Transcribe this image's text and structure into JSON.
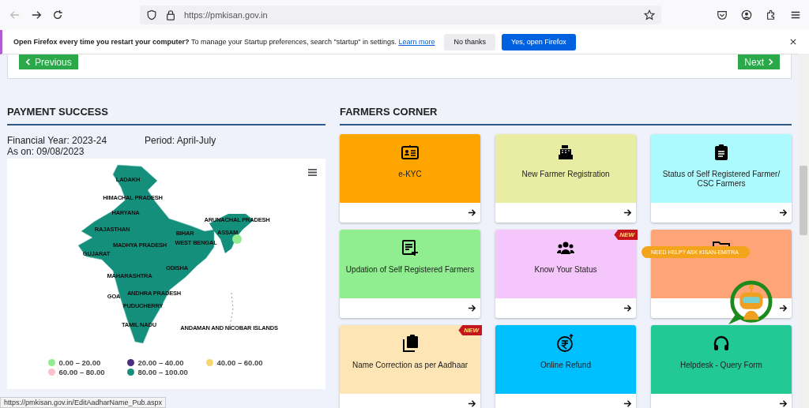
{
  "browser": {
    "url": "https://pmkisan.gov.in"
  },
  "notification": {
    "bold": "Open Firefox every time you restart your computer?",
    "text": "To manage your Startup preferences, search \"startup\" in settings.",
    "link": "Learn more",
    "buttons": [
      {
        "label": "No thanks",
        "primary": false
      },
      {
        "label": "Yes, open Firefox",
        "primary": true
      }
    ]
  },
  "pager": {
    "previous": "Previous",
    "next": "Next"
  },
  "payment_success": {
    "title": "PAYMENT SUCCESS",
    "financial_year": "Financial Year: 2023-24",
    "period": "Period: April-July",
    "as_on": "As on: 09/08/2023",
    "map_labels": [
      "LADAKH",
      "HIMACHAL PRADESH",
      "HARYANA",
      "RAJASTHAN",
      "BIHAR",
      "ARUNACHAL PRADESH",
      "ASSAM",
      "MADHYA PRADESH",
      "WEST BENGAL",
      "GUJARAT",
      "ODISHA",
      "MAHARASHTRA",
      "GOA",
      "ANDHRA PRADESH",
      "PUDUCHERRY",
      "TAMIL NADU",
      "ANDAMAN AND NICOBAR ISLANDS"
    ],
    "legend": [
      {
        "label": "0.00 – 20.00",
        "color": "#90ee90"
      },
      {
        "label": "20.00 – 40.00",
        "color": "#4b2c7f"
      },
      {
        "label": "40.00 – 60.00",
        "color": "#f5d76e"
      },
      {
        "label": "60.00 – 80.00",
        "color": "#ffc0cb"
      },
      {
        "label": "80.00 – 100.00",
        "color": "#148f7b"
      }
    ]
  },
  "farmers_corner": {
    "title": "FARMERS CORNER",
    "cards": [
      {
        "label": "e-KYC",
        "color": "#ffa500"
      },
      {
        "label": "New Farmer Registration",
        "color": "#e9eda4"
      },
      {
        "label": "Status of Self Registered Farmer/ CSC Farmers",
        "color": "#acfafd"
      },
      {
        "label": "Updation of Self Registered Farmers",
        "color": "#90ee90"
      },
      {
        "label": "Know Your Status",
        "color": "#f5c6fb",
        "badge": "NEW"
      },
      {
        "color": "#ffa477"
      },
      {
        "label": "Name Correction as per Aadhaar",
        "color": "#fde5b5",
        "badge": "NEW"
      },
      {
        "label": "Online Refund",
        "color": "#00bfff"
      },
      {
        "label": "Helpdesk - Query Form",
        "color": "#22c994"
      }
    ]
  },
  "help_bubble": "NEED HELP? ASK KISAN-EMITRA",
  "status_url": "https://pmkisan.gov.in/EditAadharName_Pub.aspx"
}
